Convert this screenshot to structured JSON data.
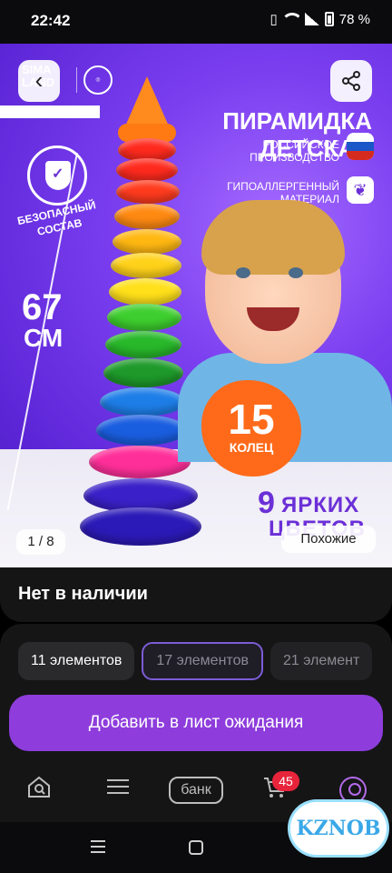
{
  "status_bar": {
    "time": "22:42",
    "battery": "78 %"
  },
  "banner": {
    "brand_logo": "SIMA LAND",
    "title_line1": "ПИРАМИДКА",
    "title_line2": "ДЕТСКАЯ",
    "feature1": "РОССИЙСКОЕ ПРОИЗВОДСТВО",
    "feature2": "ГИПОАЛЛЕРГЕННЫЙ МАТЕРИАЛ",
    "safe_label": "БЕЗОПАСНЫЙ СОСТАВ",
    "height_value": "67",
    "height_unit": "СМ",
    "rings_count": "15",
    "rings_label": "КОЛЕЦ",
    "colors_count": "9",
    "colors_word": "ЯРКИХ",
    "colors_word2": "ЦВЕТОВ",
    "page_counter": "1 / 8",
    "similar_button": "Похожие"
  },
  "availability": {
    "text": "Нет в наличии"
  },
  "options": {
    "chips": [
      "11 элементов",
      "17 элементов",
      "21 элемент"
    ],
    "selected_index": 1
  },
  "actions": {
    "waitlist_button": "Добавить в лист ожидания"
  },
  "bottom_nav": {
    "bank_label": "банк",
    "cart_badge": "45"
  },
  "watermark": "KZNOB",
  "colors": {
    "accent": "#8e3ddc",
    "background": "#000000",
    "card": "#151516",
    "badge": "#e8243b"
  }
}
